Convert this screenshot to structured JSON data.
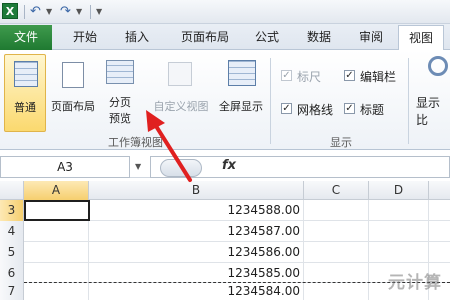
{
  "quick_access": {
    "app_icon": "excel-logo",
    "undo": "↶",
    "redo": "↷",
    "dropdown": "▼"
  },
  "tabs": [
    "文件",
    "开始",
    "插入",
    "页面布局",
    "公式",
    "数据",
    "审阅",
    "视图"
  ],
  "active_tab": "视图",
  "ribbon": {
    "workbook_views": {
      "normal": "普通",
      "page_layout": "页面布局",
      "page_break_preview_line1": "分页",
      "page_break_preview_line2": "预览",
      "custom_views": "自定义视图",
      "full_screen": "全屏显示",
      "group_label": "工作簿视图"
    },
    "show": {
      "ruler": "标尺",
      "formula_bar": "编辑栏",
      "gridlines": "网格线",
      "headings": "标题",
      "group_label": "显示",
      "ruler_checked": true,
      "formula_bar_checked": true,
      "gridlines_checked": true,
      "headings_checked": true
    },
    "zoom_label": "显示比"
  },
  "formula_bar": {
    "name_box": "A3",
    "fx": "fx",
    "value": ""
  },
  "columns": [
    "A",
    "B",
    "C",
    "D"
  ],
  "selected_column": "A",
  "rows": [
    {
      "num": "3",
      "a": "",
      "b": "1234588.00"
    },
    {
      "num": "4",
      "a": "",
      "b": "1234587.00"
    },
    {
      "num": "5",
      "a": "",
      "b": "1234586.00"
    },
    {
      "num": "6",
      "a": "",
      "b": "1234585.00"
    },
    {
      "num": "7",
      "a": "",
      "b": "1234584.00"
    }
  ],
  "selected_row": "3",
  "watermark": "元计算",
  "colors": {
    "file_tab": "#1f7a31",
    "selected_button": "#fbd96f",
    "annotation_arrow": "#e02020"
  }
}
